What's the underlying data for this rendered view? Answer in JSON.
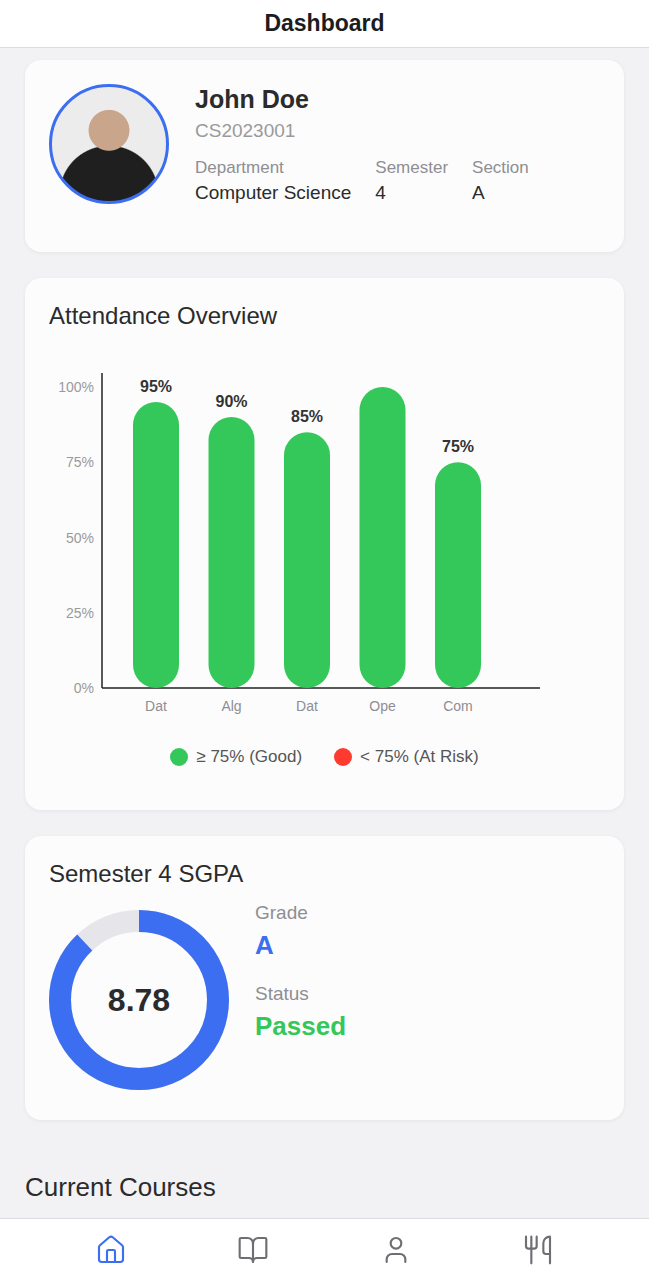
{
  "header": {
    "title": "Dashboard"
  },
  "profile": {
    "name": "John Doe",
    "id": "CS2023001",
    "fields": [
      {
        "label": "Department",
        "value": "Computer Science"
      },
      {
        "label": "Semester",
        "value": "4"
      },
      {
        "label": "Section",
        "value": "A"
      }
    ]
  },
  "attendance": {
    "title": "Attendance Overview",
    "y_max": 100,
    "y_ticks": [
      "100%",
      "75%",
      "50%",
      "25%",
      "0%"
    ],
    "threshold": 75,
    "bars": [
      {
        "category": "Dat",
        "value": 95,
        "label": "95%"
      },
      {
        "category": "Alg",
        "value": 90,
        "label": "90%"
      },
      {
        "category": "Dat",
        "value": 85,
        "label": "85%"
      },
      {
        "category": "Ope",
        "value": 100
      },
      {
        "category": "Com",
        "value": 75,
        "label": "75%"
      }
    ],
    "legend": [
      {
        "label": "≥ 75% (Good)",
        "color": "#34c759"
      },
      {
        "label": "< 75% (At Risk)",
        "color": "#ff3b30"
      }
    ]
  },
  "sgpa": {
    "title": "Semester 4 SGPA",
    "value": "8.78",
    "level": 0.878,
    "grade_label": "Grade",
    "grade": "A",
    "status_label": "Status",
    "status": "Passed"
  },
  "courses": {
    "title": "Current Courses"
  },
  "nav": [
    {
      "selected": true
    },
    {
      "selected": false
    },
    {
      "selected": false
    },
    {
      "selected": false
    }
  ]
}
